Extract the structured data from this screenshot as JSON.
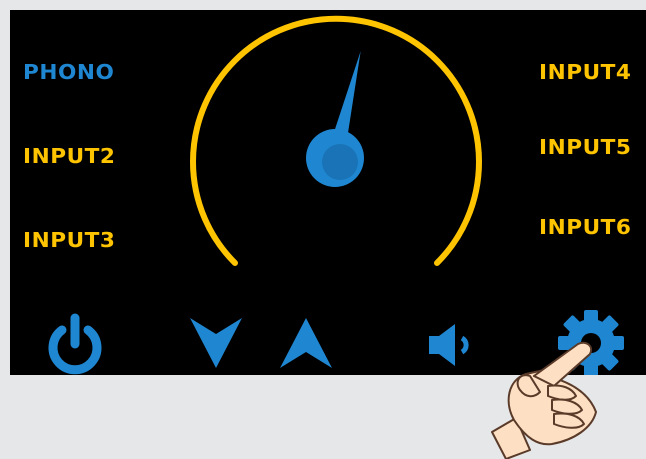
{
  "colors": {
    "screen_bg": "#000000",
    "page_bg": "#e6e7e9",
    "accent_blue": "#1f86d1",
    "accent_yellow": "#ffc400"
  },
  "inputs": [
    {
      "label": "PHONO",
      "selected": true
    },
    {
      "label": "INPUT2",
      "selected": false
    },
    {
      "label": "INPUT3",
      "selected": false
    },
    {
      "label": "INPUT4",
      "selected": false
    },
    {
      "label": "INPUT5",
      "selected": false
    },
    {
      "label": "INPUT6",
      "selected": false
    }
  ],
  "meter": {
    "needle_level_fraction": 0.55
  },
  "controls": {
    "power": {
      "icon": "power-icon"
    },
    "volume_down": {
      "icon": "chevron-down-icon"
    },
    "volume_up": {
      "icon": "chevron-up-icon"
    },
    "speaker": {
      "icon": "speaker-icon"
    },
    "settings": {
      "icon": "gear-icon"
    }
  },
  "overlay": {
    "icon": "pointing-hand-icon"
  }
}
